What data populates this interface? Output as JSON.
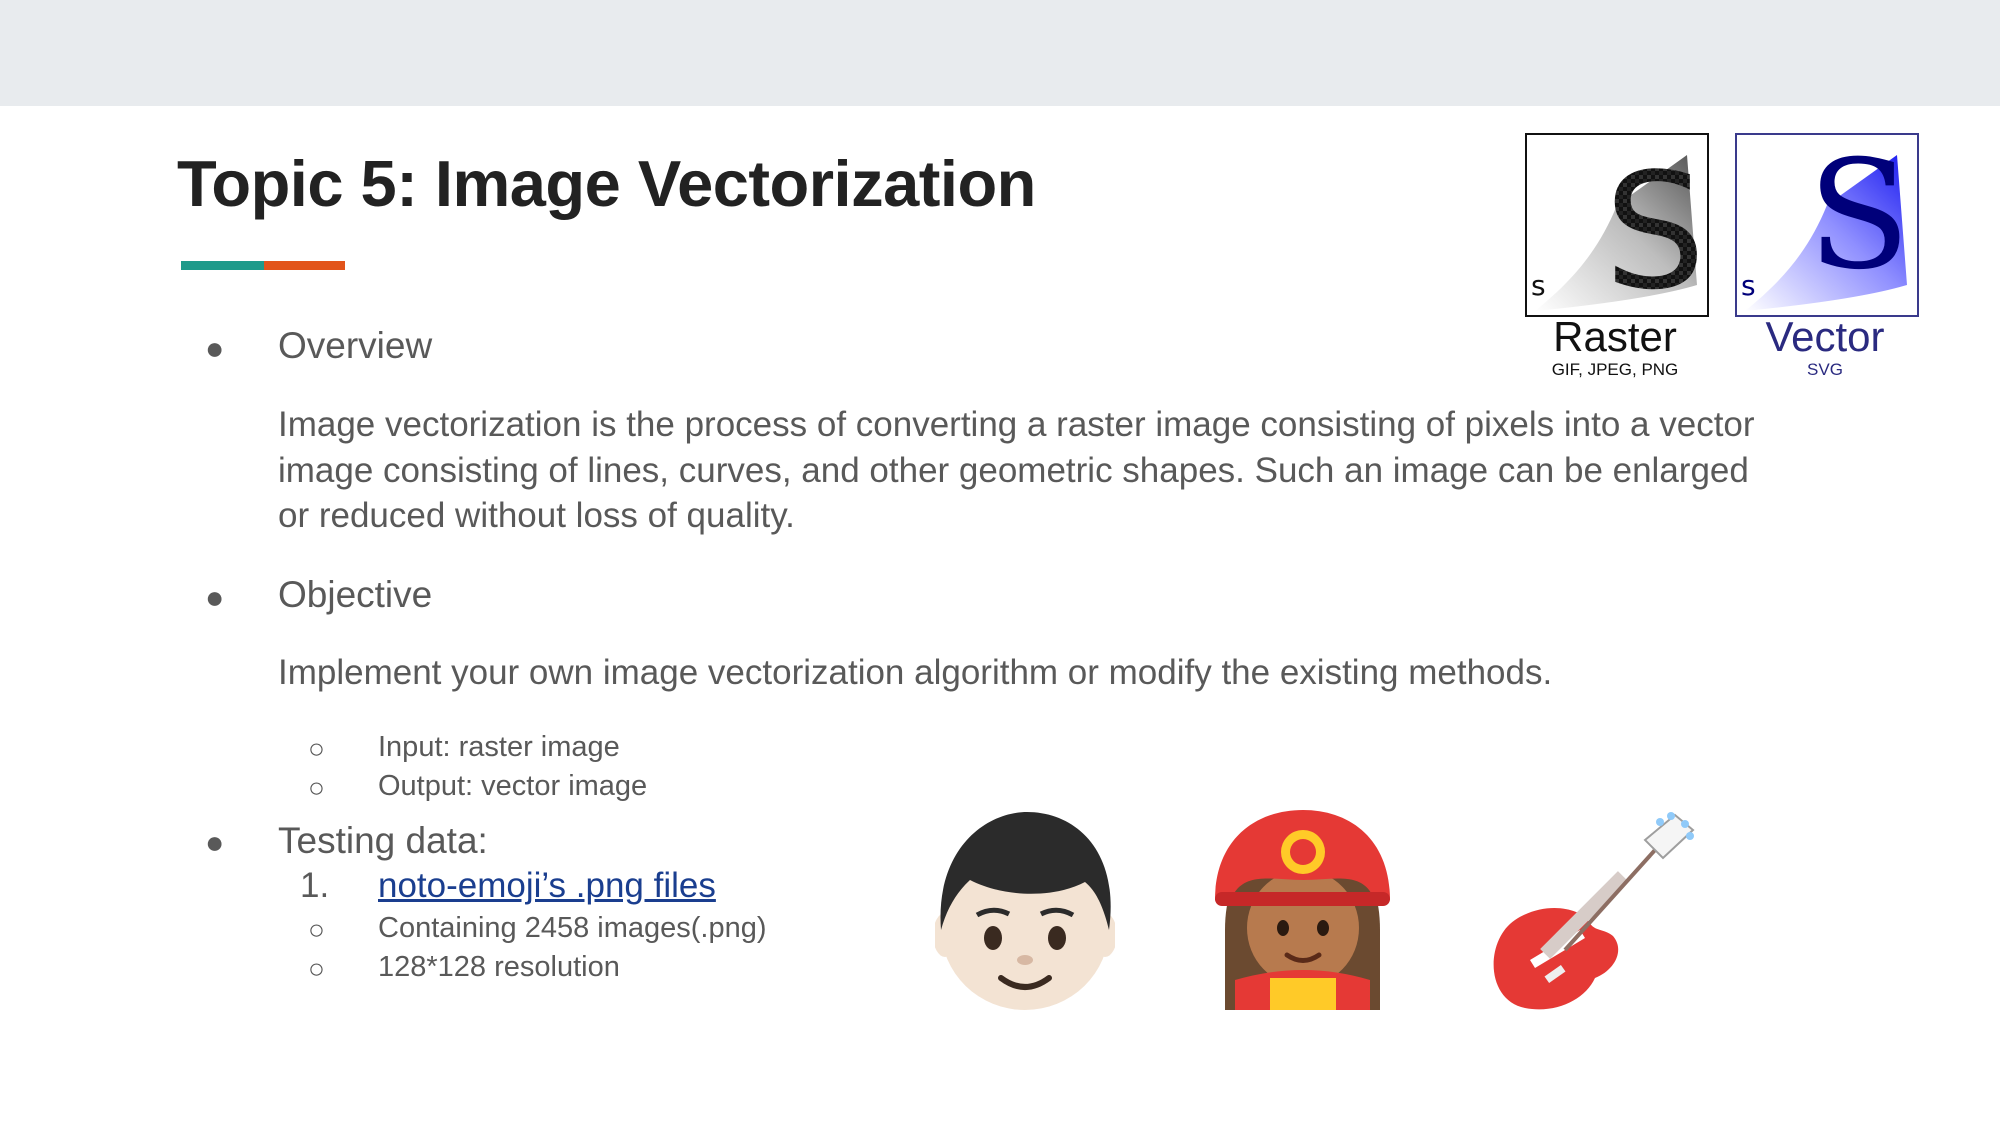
{
  "slide": {
    "title": "Topic 5: Image Vectorization",
    "sections": {
      "overview": {
        "heading": "Overview",
        "body": "Image vectorization is the process of converting a raster image consisting of pixels into a vector image consisting of lines, curves, and other geometric shapes. Such an image can be enlarged or reduced without loss of quality."
      },
      "objective": {
        "heading": "Objective",
        "body": "Implement your own image vectorization algorithm or modify the existing methods.",
        "items": [
          "Input: raster image",
          "Output: vector image"
        ]
      },
      "testing": {
        "heading": "Testing data:",
        "number": "1.",
        "link": "noto-emoji’s .png files",
        "items": [
          "Containing 2458 images(.png)",
          "128*128 resolution"
        ]
      }
    },
    "comparison": {
      "raster": {
        "glyph": "S",
        "small_glyph": "s",
        "label": "Raster",
        "formats": "GIF, JPEG, PNG"
      },
      "vector": {
        "glyph": "S",
        "small_glyph": "s",
        "label": "Vector",
        "formats": "SVG"
      }
    },
    "bullet_glyph": "●",
    "sub_bullet_glyph": "○",
    "emojis": [
      "boy-face-icon",
      "firefighter-woman-icon",
      "electric-guitar-icon"
    ],
    "colors": {
      "accent_teal": "#1e9a8a",
      "accent_orange": "#e2541a",
      "link": "#1a3e8f",
      "vector_blue": "#1a1aa0"
    }
  }
}
